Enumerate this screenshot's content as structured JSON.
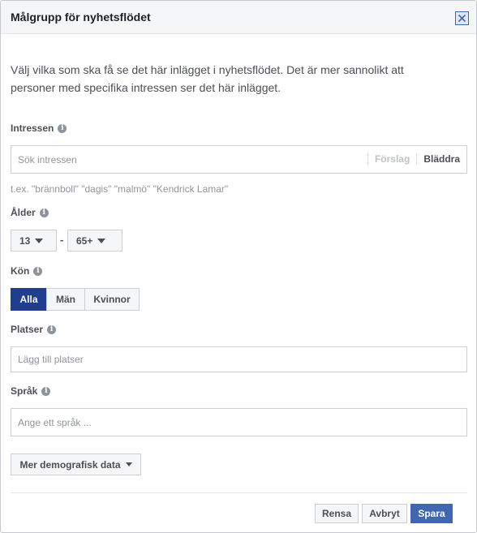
{
  "dialog": {
    "title": "Målgrupp för nyhetsflödet",
    "close_icon": "close-icon"
  },
  "intro": "Välj vilka som ska få se det här inlägget i nyhetsflödet. Det är mer sannolikt att personer med specifika intressen ser det här inlägget.",
  "interests": {
    "label": "Intressen",
    "placeholder": "Sök intressen",
    "suggest_label": "Förslag",
    "browse_label": "Bläddra",
    "hint": "t.ex. \"brännboll\" \"dagis\" \"malmö\" \"Kendrick Lamar\""
  },
  "age": {
    "label": "Ålder",
    "min_value": "13",
    "separator": "-",
    "max_value": "65+"
  },
  "gender": {
    "label": "Kön",
    "options": [
      "Alla",
      "Män",
      "Kvinnor"
    ],
    "selected": "Alla"
  },
  "locations": {
    "label": "Platser",
    "placeholder": "Lägg till platser"
  },
  "language": {
    "label": "Språk",
    "placeholder": "Ange ett språk ..."
  },
  "more_demographics_label": "Mer demografisk data",
  "footer": {
    "clear_label": "Rensa",
    "cancel_label": "Avbryt",
    "save_label": "Spara"
  },
  "colors": {
    "primary": "#4267b2",
    "selected_segment": "#213d8f"
  }
}
